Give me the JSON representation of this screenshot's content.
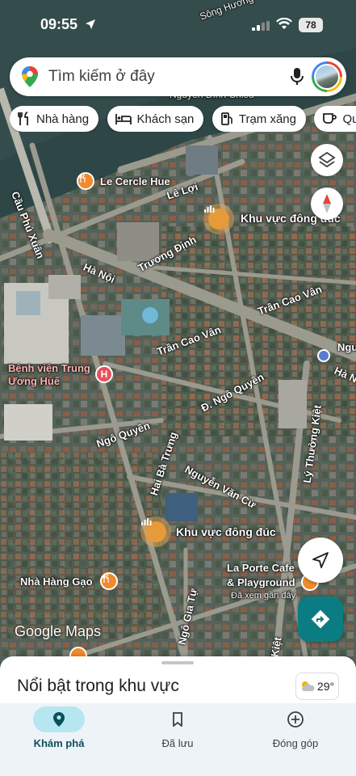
{
  "status_bar": {
    "time": "09:55",
    "battery": "78"
  },
  "search": {
    "placeholder": "Tìm kiếm ở đây"
  },
  "chips": [
    {
      "label": "Nhà hàng",
      "icon": "restaurant-icon"
    },
    {
      "label": "Khách sạn",
      "icon": "hotel-icon"
    },
    {
      "label": "Trạm xăng",
      "icon": "gas-station-icon"
    },
    {
      "label": "Quán c",
      "icon": "cafe-icon"
    }
  ],
  "map": {
    "streets": {
      "song_huong": "Sông Hương",
      "nguyen_dinh_chieu": "Nguyễn Đình Chiểu",
      "cau_phu_xuan": "Cầu Phú Xuân",
      "le_loi": "Lê Lợi",
      "truong_dinh": "Trương Định",
      "ha_noi_1": "Hà Nội",
      "ha_noi_2": "Hà N",
      "tran_cao_van_1": "Trần Cao Vân",
      "tran_cao_van_2": "Trần Cao Vân",
      "dong_ngo_quyen": "Đ. Ngô Quyền",
      "ngo_quyen": "Ngô Quyền",
      "hai_ba_trung": "Hai Bà Trưng",
      "nguyen_van_cu": "Nguyễn Văn Cừ",
      "ly_thuong_kiet": "Lý Thường Kiệt",
      "ngo_gia_tu": "Ngô Gia Tự",
      "kiet": "Kiệt",
      "ngu": "Ngu"
    },
    "places": {
      "le_cercle": "Le Cercle Hue",
      "khu_vuc_1": "Khu vực đông đúc",
      "khu_vuc_2": "Khu vực đông đúc",
      "benh_vien": "Bệnh viện Trung\nƯơng Huế",
      "nha_hang_gao": "Nhà Hàng Gạo",
      "la_porte": "La Porte Cafe\n& Playground",
      "la_porte_sub": "Đã xem gần đây"
    },
    "logo": "Google Maps"
  },
  "sheet": {
    "title": "Nổi bật trong khu vực",
    "temperature": "29°"
  },
  "nav": [
    {
      "label": "Khám phá",
      "icon": "explore-pin-icon",
      "active": true
    },
    {
      "label": "Đã lưu",
      "icon": "bookmark-icon",
      "active": false
    },
    {
      "label": "Đóng góp",
      "icon": "add-circle-icon",
      "active": false
    }
  ],
  "colors": {
    "accent": "#0b7d82",
    "nav_active": "#b6e6ef",
    "area_pin": "#e69a3a",
    "hospital": "#e8505b",
    "food_pin": "#f08a2c"
  }
}
